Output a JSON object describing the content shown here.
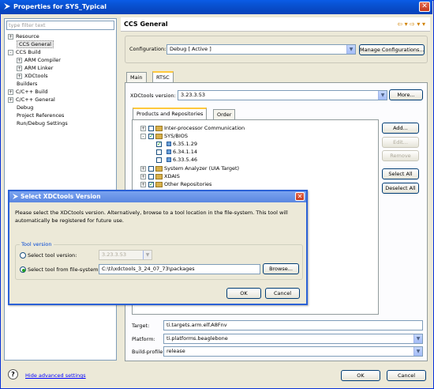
{
  "window": {
    "title": "Properties for SYS_Typical",
    "close": "✕"
  },
  "left": {
    "filter_placeholder": "type filter text",
    "items": [
      {
        "label": "Resource",
        "expander": "+",
        "indent": 0
      },
      {
        "label": "CCS General",
        "expander": "",
        "indent": 0
      },
      {
        "label": "CCS Build",
        "expander": "-",
        "indent": 0
      },
      {
        "label": "ARM Compiler",
        "expander": "+",
        "indent": 1
      },
      {
        "label": "ARM Linker",
        "expander": "+",
        "indent": 1
      },
      {
        "label": "XDCtools",
        "expander": "+",
        "indent": 1
      },
      {
        "label": "Builders",
        "expander": "",
        "indent": 0
      },
      {
        "label": "C/C++ Build",
        "expander": "+",
        "indent": 0
      },
      {
        "label": "C/C++ General",
        "expander": "+",
        "indent": 0
      },
      {
        "label": "Debug",
        "expander": "",
        "indent": 0
      },
      {
        "label": "Project References",
        "expander": "",
        "indent": 0
      },
      {
        "label": "Run/Debug Settings",
        "expander": "",
        "indent": 0
      }
    ]
  },
  "header": {
    "title": "CCS General",
    "nav": "⇦ ▾ ⇨ ▾ ▾"
  },
  "config": {
    "label": "Configuration:",
    "value": "Debug  [ Active ]",
    "manage_button": "Manage Configurations..."
  },
  "tabs": [
    "Main",
    "RTSC"
  ],
  "rtsc": {
    "xdc_label": "XDCtools version:",
    "xdc_value": "3.23.3.53",
    "more_button": "More...",
    "inner_tabs": [
      "Products and Repositories",
      "Order"
    ],
    "products": [
      {
        "label": "Inter-processor Communication",
        "level": 0,
        "checked": false,
        "exp": "+",
        "folder": true
      },
      {
        "label": "SYS/BIOS",
        "level": 0,
        "checked": true,
        "exp": "-",
        "folder": true
      },
      {
        "label": "6.35.1.29",
        "level": 1,
        "checked": true,
        "exp": "",
        "folder": false
      },
      {
        "label": "6.34.1.14",
        "level": 1,
        "checked": false,
        "exp": "",
        "folder": false
      },
      {
        "label": "6.33.5.46",
        "level": 1,
        "checked": false,
        "exp": "",
        "folder": false
      },
      {
        "label": "System Analyzer (UIA Target)",
        "level": 0,
        "checked": false,
        "exp": "+",
        "folder": true
      },
      {
        "label": "XDAIS",
        "level": 0,
        "checked": false,
        "exp": "+",
        "folder": true
      },
      {
        "label": "Other Repositories",
        "level": 0,
        "checked": true,
        "exp": "+",
        "folder": true
      }
    ],
    "side_buttons": {
      "add": "Add...",
      "edit": "Edit...",
      "remove": "Remove",
      "select_all": "Select All",
      "deselect_all": "Deselect All"
    },
    "target_label": "Target:",
    "target_value": "ti.targets.arm.elf.A8Fnv",
    "platform_label": "Platform:",
    "platform_value": "ti.platforms.beaglebone",
    "profile_label": "Build-profile:",
    "profile_value": "release"
  },
  "footer": {
    "help_icon": "?",
    "hide_advanced": "Hide advanced settings",
    "ok": "OK",
    "cancel": "Cancel"
  },
  "dialog": {
    "title": "Select XDCtools Version",
    "close": "✕",
    "message": "Please select the XDCtools version. Alternatively, browse to a tool location in the file-system. This tool will automatically be registered for future use.",
    "group_title": "Tool version",
    "opt1_label": "Select tool version:",
    "opt1_value": "3.23.3.53",
    "opt2_label": "Select tool from file-system:",
    "opt2_value": "C:\\ti\\xdctools_3_24_07_73\\packages",
    "browse": "Browse...",
    "ok": "OK",
    "cancel": "Cancel"
  }
}
